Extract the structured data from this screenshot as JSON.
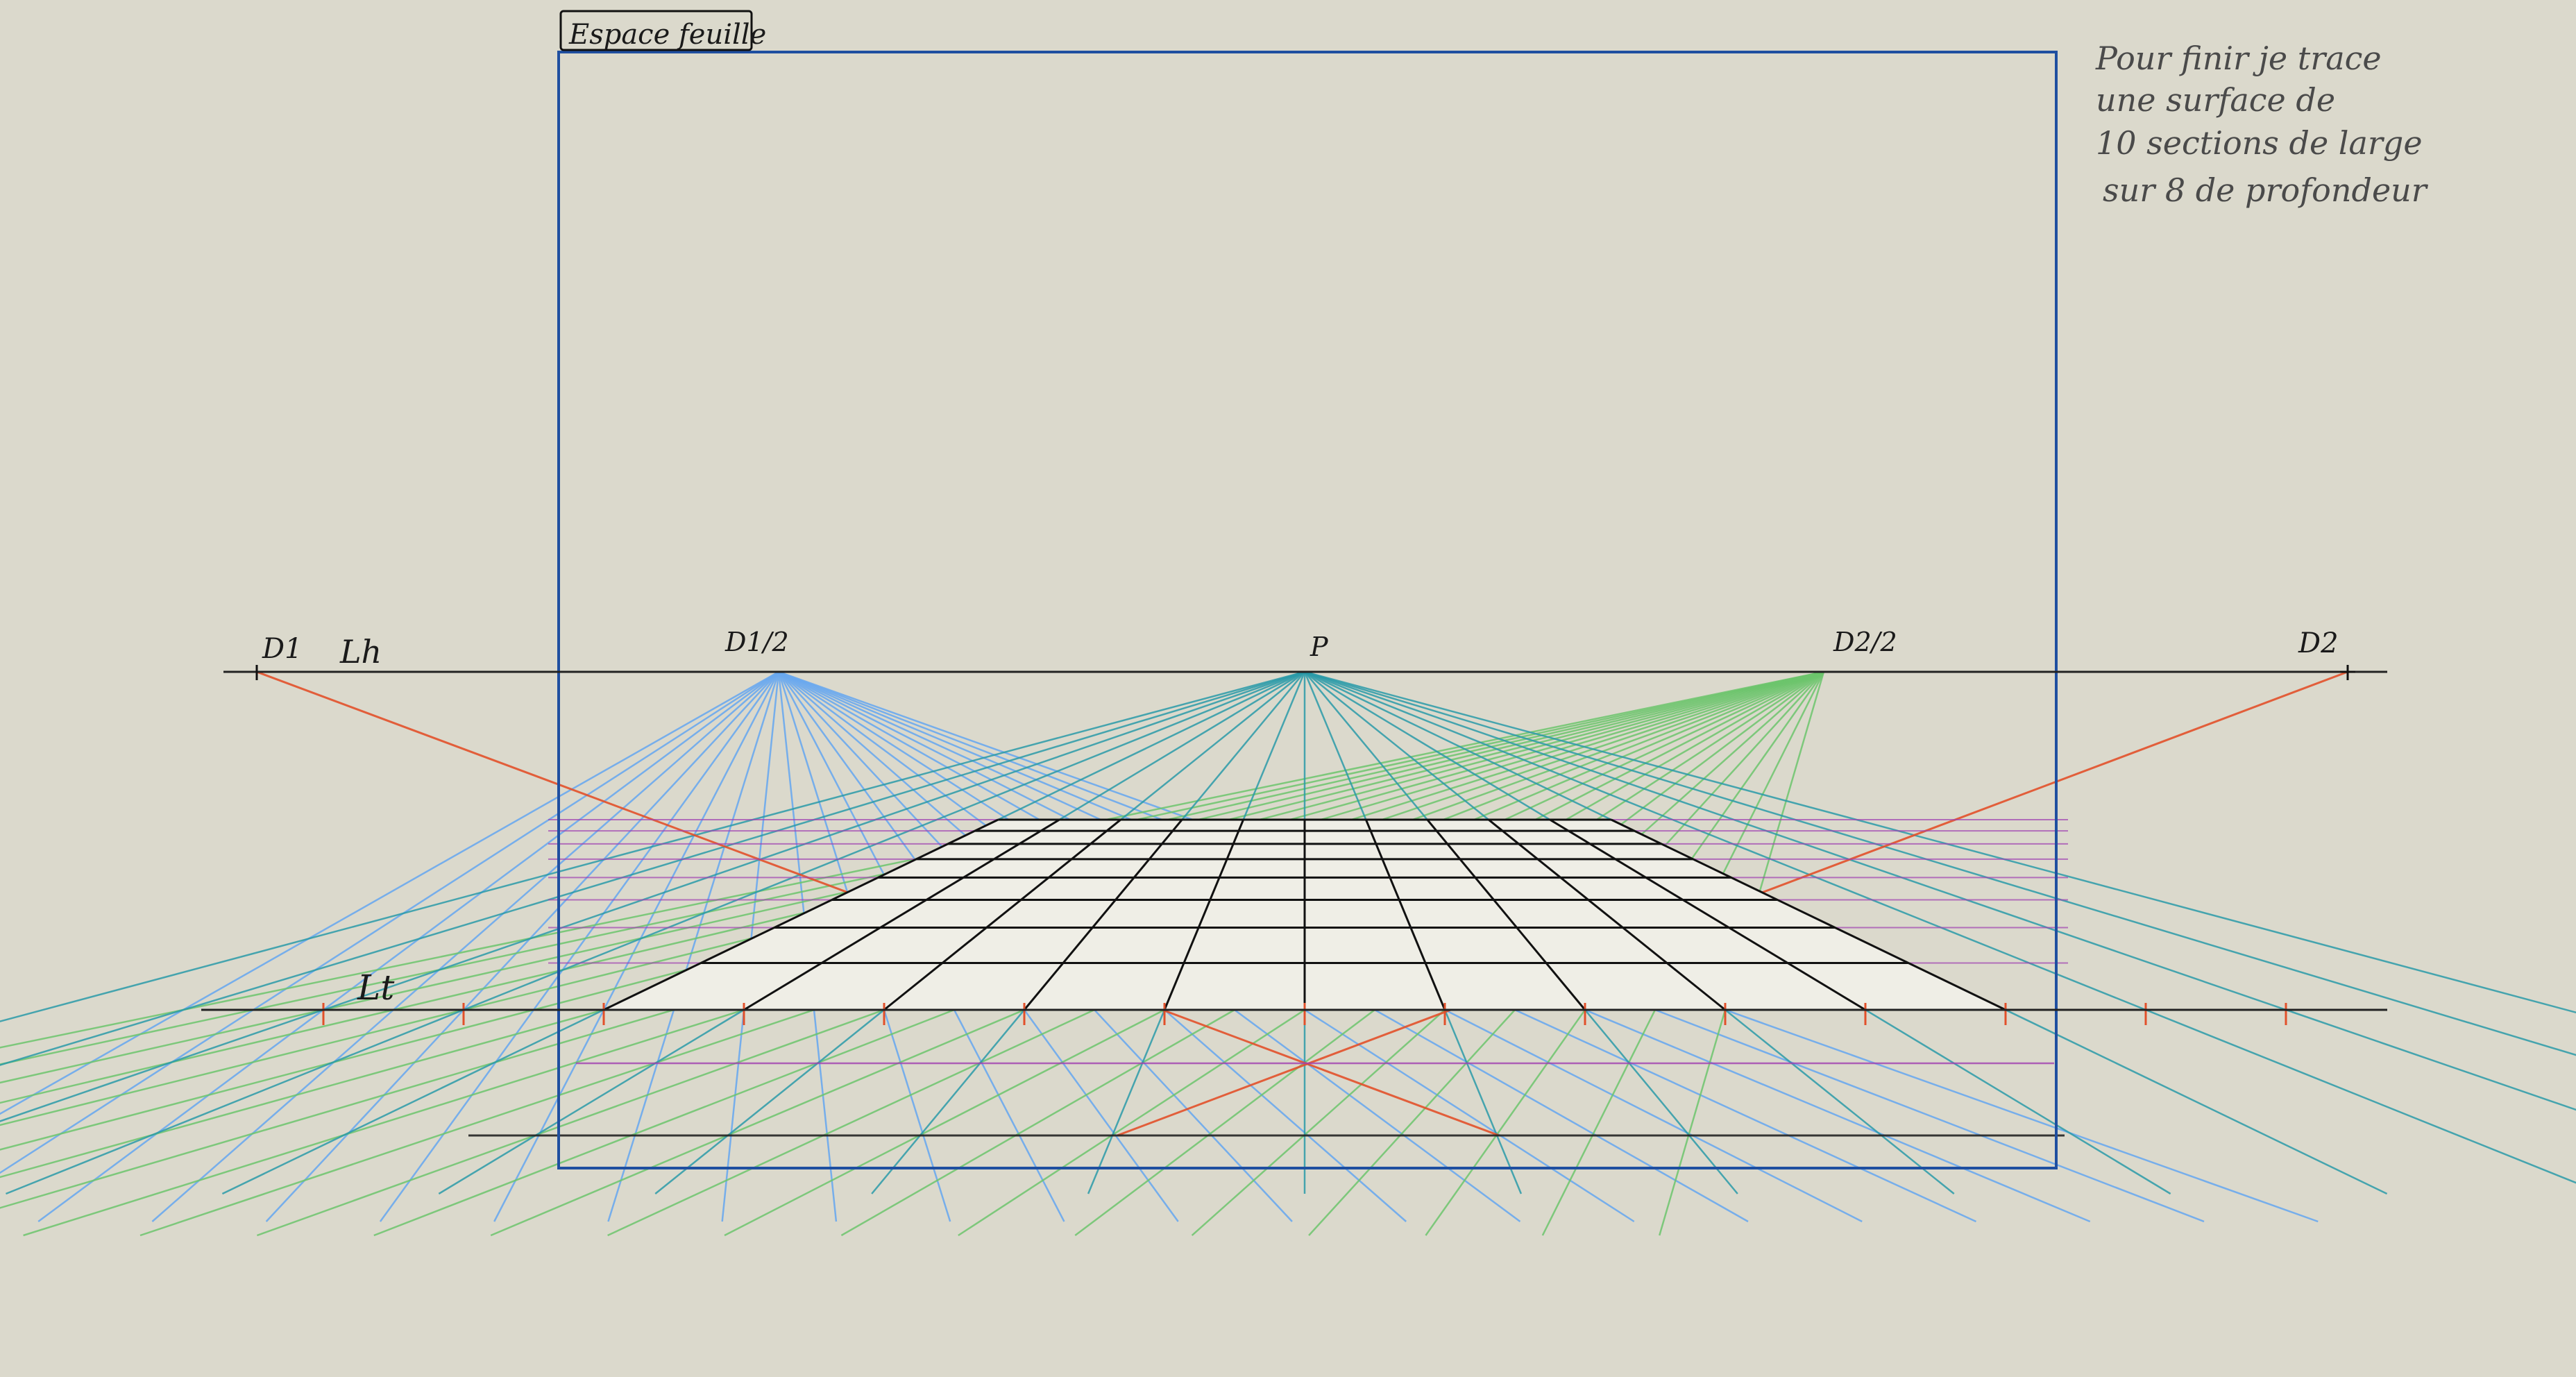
{
  "sheet_label": "Espace feuille",
  "note_lines": [
    "Pour finir je trace",
    "une surface de",
    "10 sections de large",
    "sur 8 de profondeur"
  ],
  "labels": {
    "d1": "D1",
    "lh": "Lh",
    "d1_half": "D1/2",
    "p": "P",
    "d2_half": "D2/2",
    "d2": "D2",
    "lt": "Lt"
  },
  "grid": {
    "width_sections": 10,
    "depth_sections": 8
  },
  "colors": {
    "background": "#dbd9cc",
    "sheet_frame": "#1f4fa0",
    "horizon": "#222222",
    "grid_line": "#111111",
    "vanishing_p": "#2a9aa8",
    "d1_half_rays": "#6aa8ee",
    "d2_half_rays": "#6cc46c",
    "distance_rays": "#e2502a",
    "depth_lines": "#a040b0",
    "grid_fill": "#efeee6"
  }
}
